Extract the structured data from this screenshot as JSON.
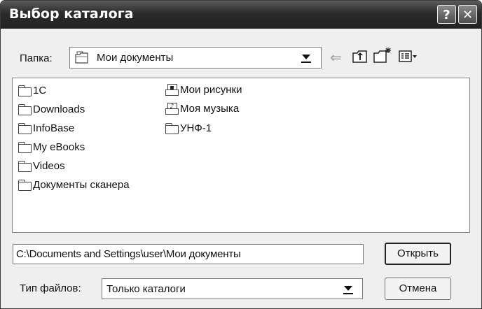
{
  "window": {
    "title": "Выбор каталога",
    "help_button": "?",
    "close_button": "✕"
  },
  "toolbar": {
    "folder_label": "Папка:",
    "current_folder": "Мои документы",
    "icons": [
      "back-arrow-icon",
      "up-folder-icon",
      "new-folder-icon",
      "view-menu-icon"
    ]
  },
  "file_list": {
    "column1": [
      {
        "name": "1C",
        "icon": "folder-icon"
      },
      {
        "name": "Downloads",
        "icon": "folder-icon"
      },
      {
        "name": "InfoBase",
        "icon": "folder-icon"
      },
      {
        "name": "My eBooks",
        "icon": "folder-icon"
      },
      {
        "name": "Videos",
        "icon": "folder-icon"
      },
      {
        "name": "Документы сканера",
        "icon": "folder-icon"
      }
    ],
    "column2": [
      {
        "name": "Мои рисунки",
        "icon": "pictures-folder-icon"
      },
      {
        "name": "Моя музыка",
        "icon": "music-folder-icon"
      },
      {
        "name": "УНФ-1",
        "icon": "folder-icon"
      }
    ]
  },
  "path": {
    "value": "C:\\Documents and Settings\\user\\Мои документы"
  },
  "filetype": {
    "label": "Тип файлов:",
    "value": "Только каталоги"
  },
  "buttons": {
    "open": "Открыть",
    "cancel": "Отмена"
  }
}
